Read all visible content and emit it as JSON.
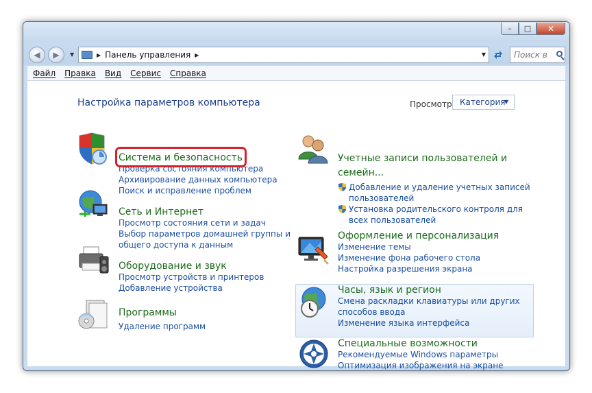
{
  "window": {
    "controls": {
      "minimize": "–",
      "maximize": "□",
      "close": "✕"
    }
  },
  "nav": {
    "back": "◀",
    "forward": "▶",
    "address": "Панель управления",
    "address_arrow": "▶",
    "address_arrow_end": "▶",
    "search_placeholder": "Поиск в пан..."
  },
  "menu": [
    "Файл",
    "Правка",
    "Вид",
    "Сервис",
    "Справка"
  ],
  "header": {
    "title": "Настройка параметров компьютера",
    "view_label": "Просмотр:",
    "view_value": "Категория"
  },
  "categories": {
    "system": {
      "title": "Система и безопасность",
      "links": [
        "Проверка состояния компьютера",
        "Архивирование данных компьютера",
        "Поиск и исправление проблем"
      ]
    },
    "network": {
      "title": "Сеть и Интернет",
      "links": [
        "Просмотр состояния сети и задач",
        "Выбор параметров домашней группы и",
        "общего доступа к данным"
      ]
    },
    "hardware": {
      "title": "Оборудование и звук",
      "links": [
        "Просмотр устройств и принтеров",
        "Добавление устройства"
      ]
    },
    "programs": {
      "title": "Программы",
      "links": [
        "Удаление программ"
      ]
    },
    "users": {
      "title_line1": "Учетные записи пользователей и",
      "title_line2": "семейн...",
      "links": [
        "Добавление и удаление учетных записей",
        "пользователей",
        "Установка родительского контроля для",
        "всех пользователей"
      ]
    },
    "appearance": {
      "title": "Оформление и персонализация",
      "links": [
        "Изменение темы",
        "Изменение фона рабочего стола",
        "Настройка разрешения экрана"
      ]
    },
    "clock": {
      "title": "Часы, язык и регион",
      "links": [
        "Смена раскладки клавиатуры или других",
        "способов ввода",
        "Изменение языка интерфейса"
      ]
    },
    "access": {
      "title": "Специальные возможности",
      "links": [
        "Рекомендуемые Windows параметры",
        "Оптимизация изображения на экране"
      ]
    }
  },
  "colors": {
    "category_title": "#1d6b1d",
    "link": "#1a4fa0",
    "highlight": "#d4222c"
  }
}
